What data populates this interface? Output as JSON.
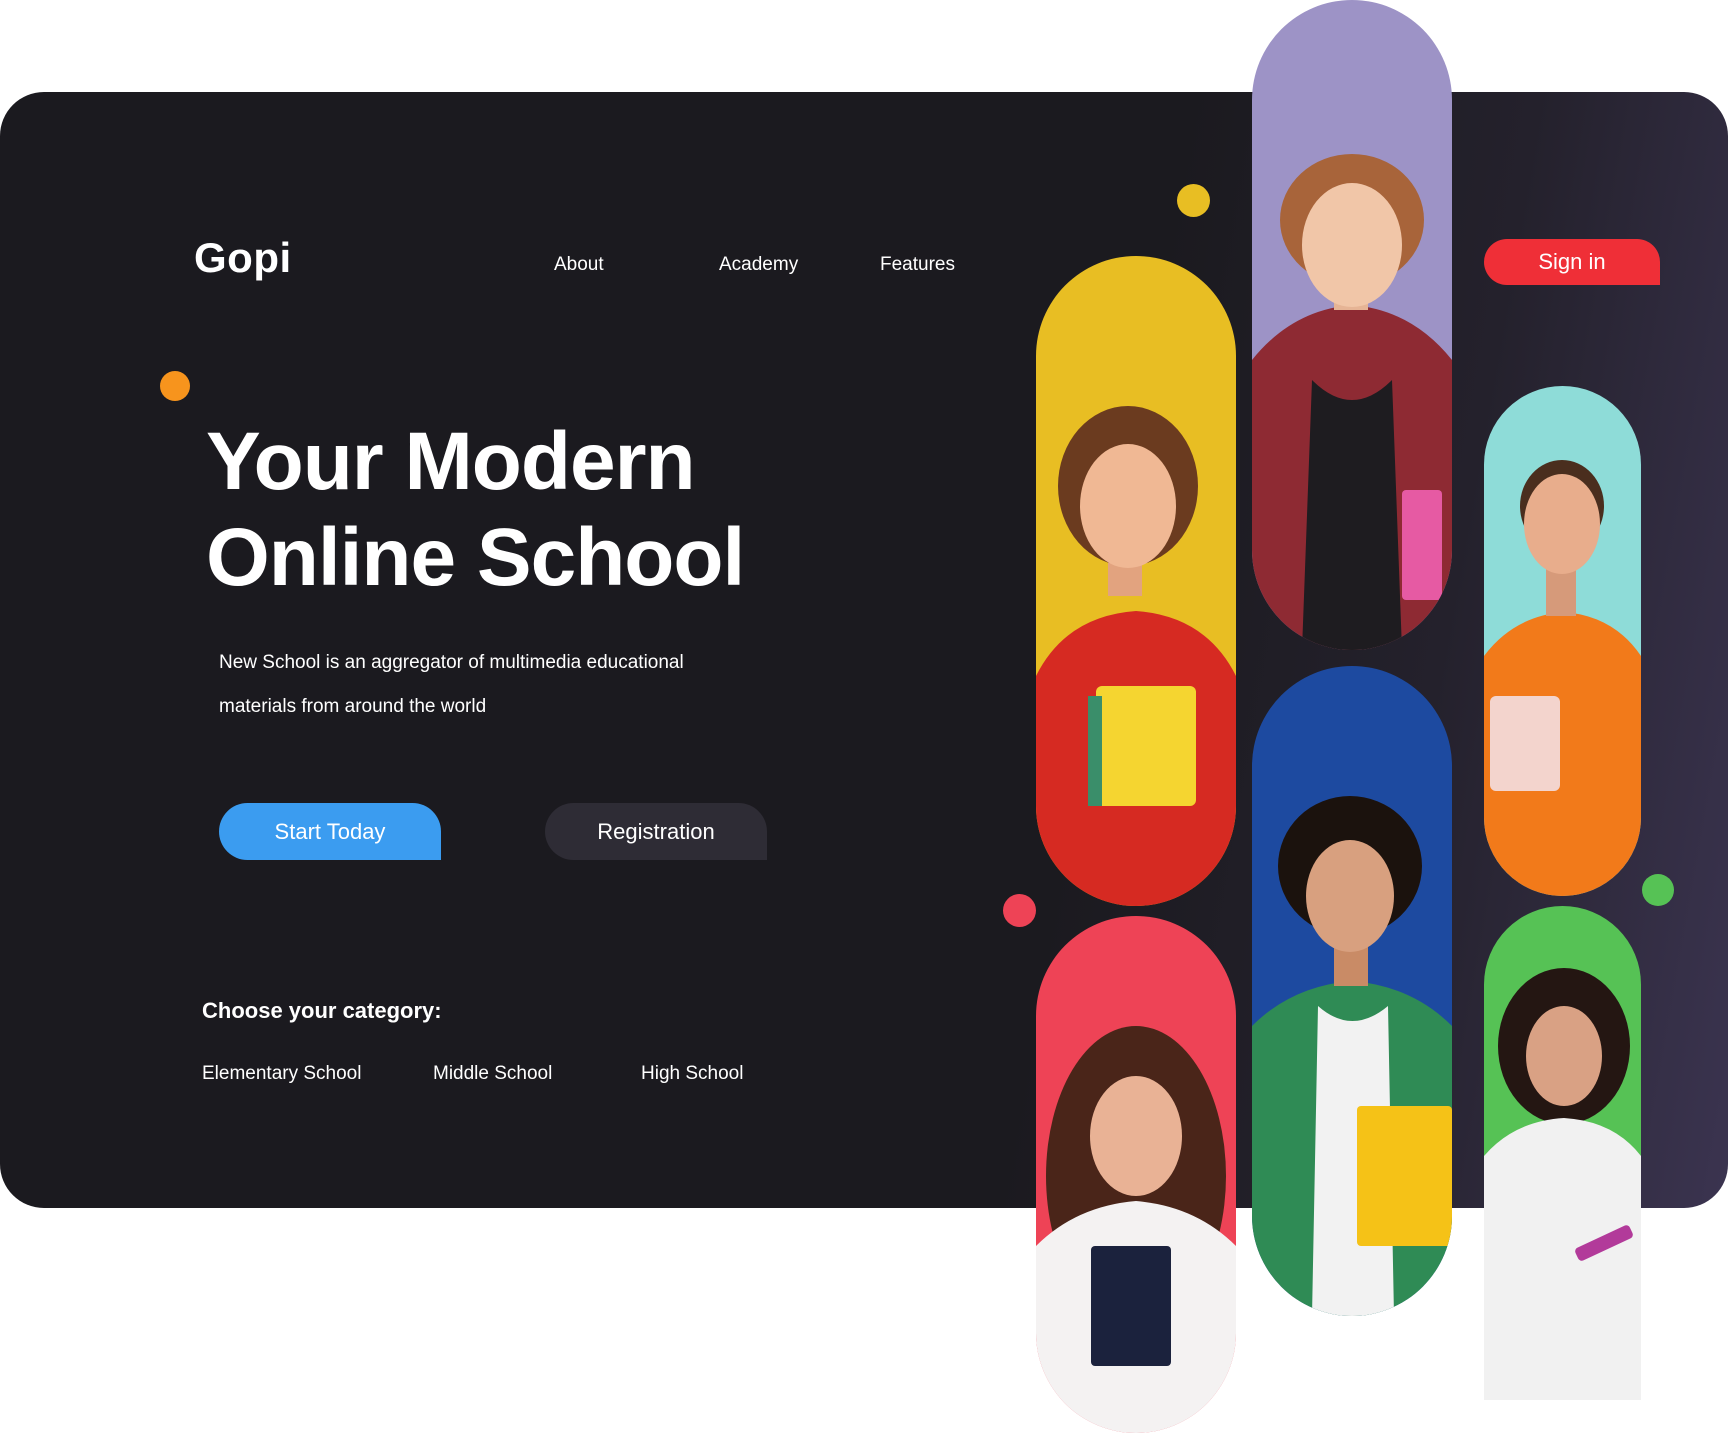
{
  "brand": {
    "logo": "Gopi"
  },
  "nav": {
    "items": [
      {
        "label": "About"
      },
      {
        "label": "Academy"
      },
      {
        "label": "Features"
      }
    ],
    "sign_in": "Sign in"
  },
  "hero": {
    "title_line1": "Your Modern",
    "title_line2": "Online School",
    "description": "New School is an aggregator of multimedia educational materials from around the world",
    "primary_button": "Start Today",
    "secondary_button": "Registration"
  },
  "categories": {
    "heading": "Choose your category:",
    "items": [
      {
        "label": "Elementary School"
      },
      {
        "label": "Middle School"
      },
      {
        "label": "High School"
      }
    ]
  },
  "colors": {
    "card_background": "#1b1a1f",
    "accent_red": "#ef2f37",
    "accent_blue": "#3b9cf0",
    "secondary_button": "#2e2c35",
    "pill_yellow": "#e8be23",
    "pill_lavender": "#9d93c6",
    "pill_teal": "#8edcd8",
    "pill_red": "#ee4356",
    "pill_blue": "#1d4aa0",
    "pill_green": "#56c255"
  },
  "photos": [
    {
      "icon": "student-portrait-icon",
      "background": "#e8be23",
      "shirt": "#d62a22"
    },
    {
      "icon": "student-portrait-icon",
      "background": "#9d93c6",
      "shirt": "#1e1c20"
    },
    {
      "icon": "student-portrait-icon",
      "background": "#8edcd8",
      "shirt": "#f27a1a"
    },
    {
      "icon": "student-portrait-icon",
      "background": "#ee4356",
      "shirt": "#f4f2f2"
    },
    {
      "icon": "student-portrait-icon",
      "background": "#1d4aa0",
      "shirt": "#2f8b55"
    },
    {
      "icon": "student-portrait-icon",
      "background": "#56c255",
      "shirt": "#f1f1f1"
    }
  ]
}
